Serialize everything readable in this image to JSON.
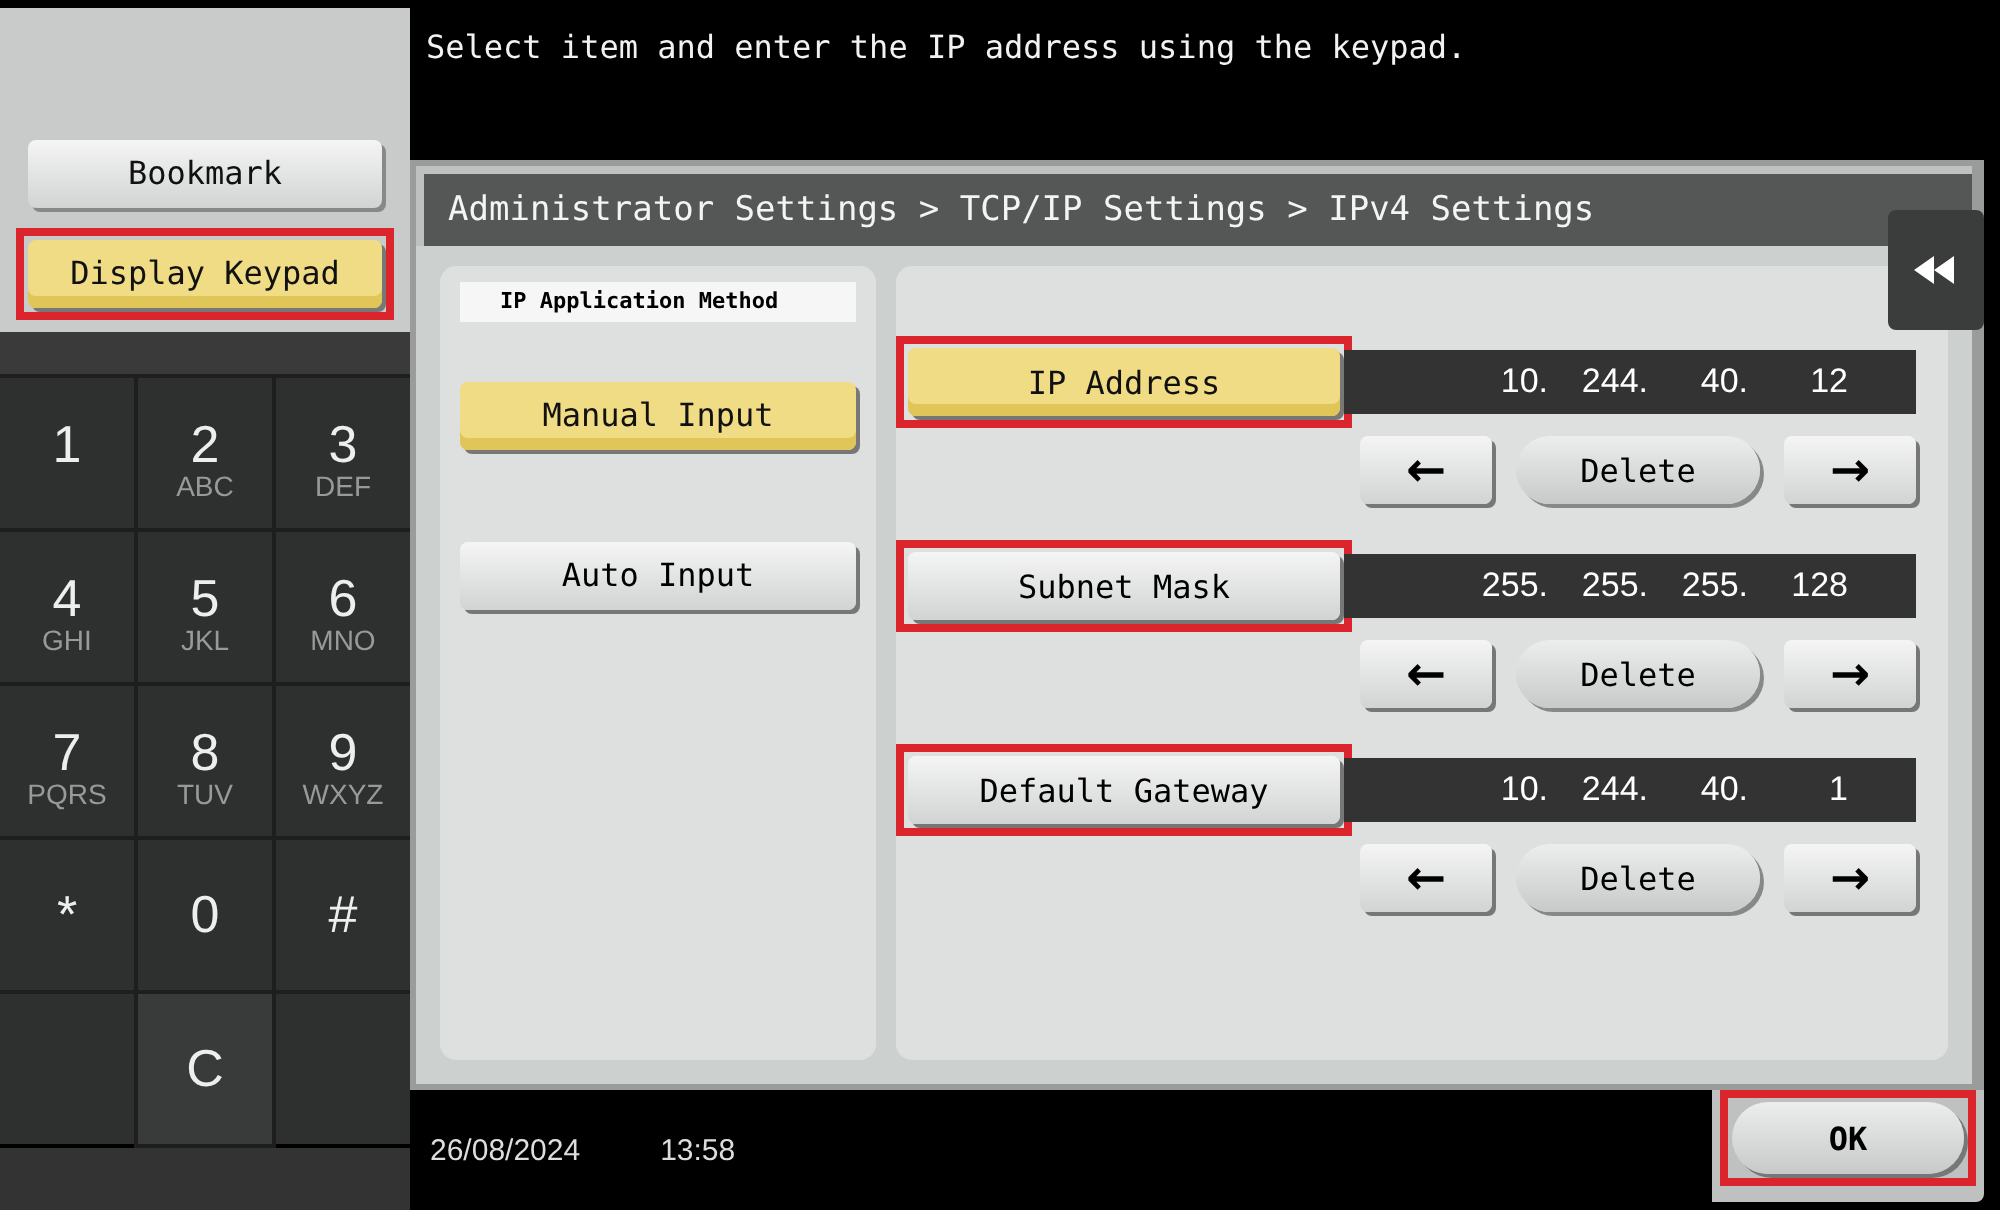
{
  "message": "Select item and enter the IP address using the keypad.",
  "side_buttons": [
    {
      "label": "Bookmark",
      "selected": false,
      "highlighted": false
    },
    {
      "label": "Display Keypad",
      "selected": true,
      "highlighted": true
    }
  ],
  "keypad": [
    {
      "digit": "1"
    },
    {
      "digit": "2",
      "letters": "ABC"
    },
    {
      "digit": "3",
      "letters": "DEF"
    },
    {
      "digit": "4",
      "letters": "GHI"
    },
    {
      "digit": "5",
      "letters": "JKL"
    },
    {
      "digit": "6",
      "letters": "MNO"
    },
    {
      "digit": "7",
      "letters": "PQRS"
    },
    {
      "digit": "8",
      "letters": "TUV"
    },
    {
      "digit": "9",
      "letters": "WXYZ"
    },
    {
      "digit": "*"
    },
    {
      "digit": "0"
    },
    {
      "digit": "#"
    },
    {
      "digit": "C"
    }
  ],
  "breadcrumb": "Administrator Settings > TCP/IP Settings > IPv4 Settings",
  "method": {
    "label": "IP Application Method",
    "options": [
      {
        "label": "Manual Input",
        "selected": true
      },
      {
        "label": "Auto Input",
        "selected": false
      }
    ]
  },
  "fields": [
    {
      "label": "IP Address",
      "selected": true,
      "highlighted": true,
      "octets": [
        "10.",
        "244.",
        "40.",
        "12"
      ],
      "left": "←",
      "delete": "Delete",
      "right": "→"
    },
    {
      "label": "Subnet Mask",
      "selected": false,
      "highlighted": true,
      "octets": [
        "255.",
        "255.",
        "255.",
        "128"
      ],
      "left": "←",
      "delete": "Delete",
      "right": "→"
    },
    {
      "label": "Default Gateway",
      "selected": false,
      "highlighted": true,
      "octets": [
        "10.",
        "244.",
        "40.",
        "1"
      ],
      "left": "←",
      "delete": "Delete",
      "right": "→"
    }
  ],
  "status_bar": {
    "date": "26/08/2024",
    "time": "13:58"
  },
  "ok_button": {
    "label": "OK",
    "highlighted": true
  }
}
